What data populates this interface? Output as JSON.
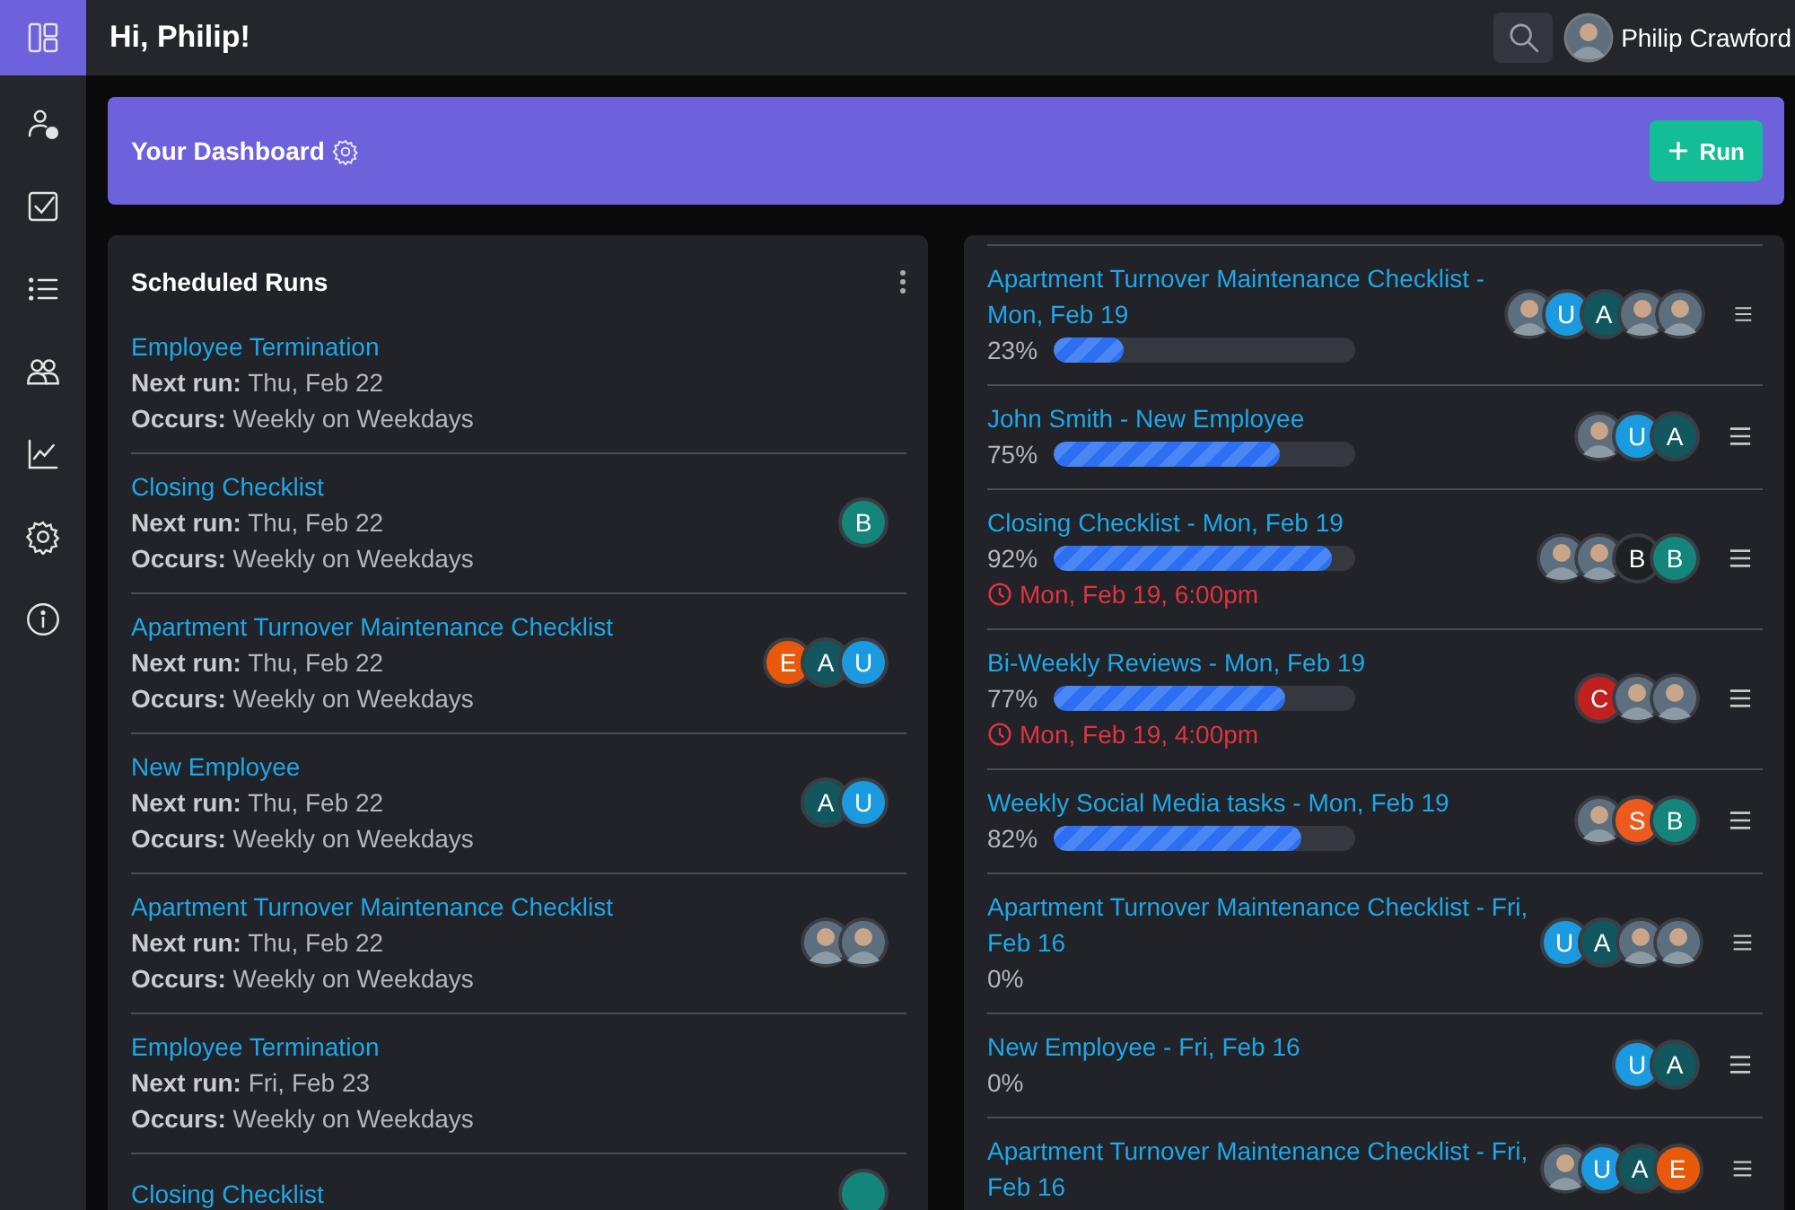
{
  "sidebar": {
    "items": [
      {
        "kind": "dashboard",
        "selected": true
      },
      {
        "kind": "user-check",
        "selected": false
      },
      {
        "kind": "checkbox",
        "selected": false
      },
      {
        "kind": "list",
        "selected": false
      },
      {
        "kind": "users",
        "selected": false
      },
      {
        "kind": "chart",
        "selected": false
      },
      {
        "kind": "settings",
        "selected": false
      },
      {
        "kind": "info",
        "selected": false
      }
    ]
  },
  "header": {
    "greeting": "Hi, Philip!",
    "user": {
      "name": "Philip Crawford"
    }
  },
  "banner": {
    "title": "Your Dashboard",
    "button": "Run"
  },
  "scheduled_runs": {
    "title": "Scheduled Runs",
    "items": [
      {
        "title": "Employee Termination",
        "next": "**Next run:** Thu, Feb 22",
        "occurs": "**Occurs:** Weekly on Weekdays"
      },
      {
        "title": "Closing Checklist",
        "next": "**Next run:** Thu, Feb 22",
        "occurs": "**Occurs:** Weekly on Weekdays",
        "assignees": [
          {
            "kind": "letter",
            "letter": "B",
            "color": "#13857a"
          }
        ]
      },
      {
        "title": "Apartment Turnover Maintenance Checklist",
        "next": "**Next run:** Thu, Feb 22",
        "occurs": "**Occurs:** Weekly on Weekdays",
        "assignees": [
          {
            "kind": "letter",
            "letter": "E",
            "color": "#e8590c"
          },
          {
            "kind": "letter",
            "letter": "A",
            "color": "#12575e"
          },
          {
            "kind": "letter",
            "letter": "U",
            "color": "#1b9ae0"
          }
        ]
      },
      {
        "title": "New Employee",
        "next": "**Next run:** Thu, Feb 22",
        "occurs": "**Occurs:** Weekly on Weekdays",
        "assignees": [
          {
            "kind": "letter",
            "letter": "A",
            "color": "#12575e"
          },
          {
            "kind": "letter",
            "letter": "U",
            "color": "#1b9ae0"
          }
        ]
      },
      {
        "title": "Apartment Turnover Maintenance Checklist",
        "next": "**Next run:** Thu, Feb 22",
        "occurs": "**Occurs:** Weekly on Weekdays",
        "assignees": [
          {
            "kind": "photo"
          },
          {
            "kind": "photo"
          }
        ]
      },
      {
        "title": "Employee Termination",
        "next": "**Next run:** Fri, Feb 23",
        "occurs": "**Occurs:** Weekly on Weekdays"
      },
      {
        "title": "Closing Checklist",
        "assignees": [
          {
            "kind": "letter",
            "color": "#13857a"
          }
        ]
      }
    ]
  },
  "runs": {
    "items": [
      {
        "title": "Apartment Turnover Maintenance Checklist - Mon, Feb 19",
        "percent": "23%",
        "level": 0.23,
        "assignees": [
          {
            "kind": "photo"
          },
          {
            "kind": "letter",
            "letter": "U",
            "color": "#1b9ae0"
          },
          {
            "kind": "letter",
            "letter": "A",
            "color": "#12575e"
          },
          {
            "kind": "photo"
          },
          {
            "kind": "photo"
          }
        ]
      },
      {
        "title": "John Smith - New Employee",
        "percent": "75%",
        "level": 0.75,
        "assignees": [
          {
            "kind": "photo"
          },
          {
            "kind": "letter",
            "letter": "U",
            "color": "#1b9ae0"
          },
          {
            "kind": "letter",
            "letter": "A",
            "color": "#12575e"
          }
        ]
      },
      {
        "title": "Closing Checklist - Mon, Feb 19",
        "percent": "92%",
        "level": 0.92,
        "due": "Mon, Feb 19, 6:00pm",
        "assignees": [
          {
            "kind": "photo"
          },
          {
            "kind": "photo"
          },
          {
            "kind": "letter",
            "letter": "B",
            "color": "#1f2023"
          },
          {
            "kind": "letter",
            "letter": "B",
            "color": "#13857a"
          }
        ]
      },
      {
        "title": "Bi-Weekly Reviews - Mon, Feb 19",
        "percent": "77%",
        "level": 0.77,
        "due": "Mon, Feb 19, 4:00pm",
        "assignees": [
          {
            "kind": "letter",
            "letter": "C",
            "color": "#c0201f"
          },
          {
            "kind": "photo"
          },
          {
            "kind": "photo"
          }
        ]
      },
      {
        "title": "Weekly Social Media tasks - Mon, Feb 19",
        "percent": "82%",
        "level": 0.82,
        "assignees": [
          {
            "kind": "photo"
          },
          {
            "kind": "letter",
            "letter": "S",
            "color": "#ee5a1d"
          },
          {
            "kind": "letter",
            "letter": "B",
            "color": "#13857a"
          }
        ]
      },
      {
        "title": "Apartment Turnover Maintenance Checklist - Fri, Feb 16",
        "percent": "0%",
        "assignees": [
          {
            "kind": "letter",
            "letter": "U",
            "color": "#1b9ae0"
          },
          {
            "kind": "letter",
            "letter": "A",
            "color": "#12575e"
          },
          {
            "kind": "photo"
          },
          {
            "kind": "photo"
          }
        ]
      },
      {
        "title": "New Employee - Fri, Feb 16",
        "percent": "0%",
        "assignees": [
          {
            "kind": "letter",
            "letter": "U",
            "color": "#1b9ae0"
          },
          {
            "kind": "letter",
            "letter": "A",
            "color": "#12575e"
          }
        ]
      },
      {
        "title": "Apartment Turnover Maintenance Checklist - Fri, Feb 16",
        "assignees": [
          {
            "kind": "photo"
          },
          {
            "kind": "letter",
            "letter": "U",
            "color": "#1b9ae0"
          },
          {
            "kind": "letter",
            "letter": "A",
            "color": "#12575e"
          },
          {
            "kind": "letter",
            "letter": "E",
            "color": "#e8590c"
          }
        ]
      }
    ]
  }
}
